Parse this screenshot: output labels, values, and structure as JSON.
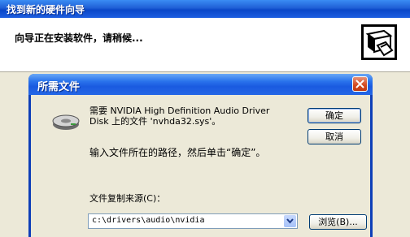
{
  "wizard": {
    "title": "找到新的硬件向导",
    "status": "向导正在安装软件，请稍候..."
  },
  "dialog": {
    "title": "所需文件",
    "message": "需要 NVIDIA High Definition Audio Driver\nDisk 上的文件 'nvhda32.sys'。",
    "prompt": "输入文件所在的路径，然后单击“确定”。",
    "source_label": "文件复制来源(C)：",
    "source_value": "c:\\drivers\\audio\\nvidia",
    "ok_label": "确定",
    "cancel_label": "取消",
    "browse_label": "浏览(B)..."
  },
  "icons": {
    "wizard_logo": "hardware-wizard-icon",
    "disk": "disk-drive-icon",
    "close": "close-icon",
    "dropdown": "chevron-down-icon"
  },
  "colors": {
    "titlebar": "#1f5fd6",
    "window_bg": "#ece9d8",
    "close_button": "#d3481e"
  }
}
